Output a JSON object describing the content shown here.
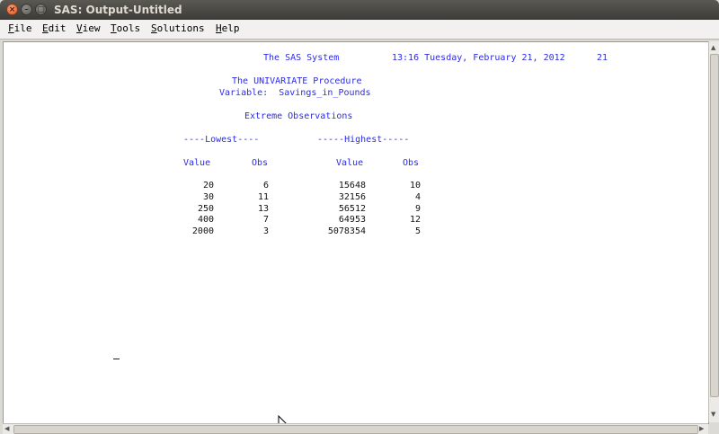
{
  "window": {
    "title": "SAS: Output-Untitled"
  },
  "menu": [
    {
      "label": "File",
      "key": "F",
      "rest": "ile"
    },
    {
      "label": "Edit",
      "key": "E",
      "rest": "dit"
    },
    {
      "label": "View",
      "key": "V",
      "rest": "iew"
    },
    {
      "label": "Tools",
      "key": "T",
      "rest": "ools"
    },
    {
      "label": "Solutions",
      "key": "S",
      "rest": "olutions"
    },
    {
      "label": "Help",
      "key": "H",
      "rest": "elp"
    }
  ],
  "output": {
    "header_system": "The SAS System",
    "header_datetime": "13:16 Tuesday, February 21, 2012",
    "header_page": "21",
    "procedure": "The UNIVARIATE Procedure",
    "variable_line": "Variable:  Savings_in_Pounds",
    "section_title": "Extreme Observations",
    "lowest_label": "----Lowest----",
    "highest_label": "-----Highest-----",
    "col_value": "Value",
    "col_obs": "Obs",
    "lowest": [
      {
        "value": "20",
        "obs": "6"
      },
      {
        "value": "30",
        "obs": "11"
      },
      {
        "value": "250",
        "obs": "13"
      },
      {
        "value": "400",
        "obs": "7"
      },
      {
        "value": "2000",
        "obs": "3"
      }
    ],
    "highest": [
      {
        "value": "15648",
        "obs": "10"
      },
      {
        "value": "32156",
        "obs": "4"
      },
      {
        "value": "56512",
        "obs": "9"
      },
      {
        "value": "64953",
        "obs": "12"
      },
      {
        "value": "5078354",
        "obs": "5"
      }
    ]
  }
}
